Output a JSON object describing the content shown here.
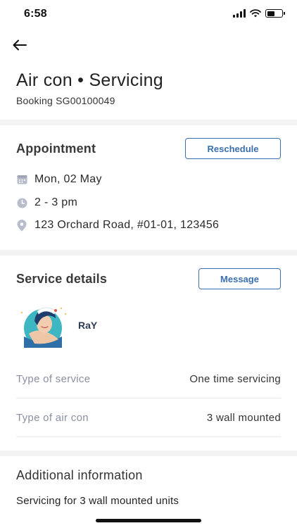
{
  "status_bar": {
    "time": "6:58",
    "battery_level": 0.5
  },
  "nav": {
    "back_icon": "arrow-left-icon"
  },
  "header": {
    "title": "Air con • Servicing",
    "booking": "Booking SG00100049"
  },
  "appointment": {
    "title": "Appointment",
    "reschedule_label": "Reschedule",
    "date": "Mon, 02 May",
    "time": "2 - 3 pm",
    "address": "123 Orchard Road, #01-01, 123456"
  },
  "service_details": {
    "title": "Service details",
    "message_label": "Message",
    "provider_name": "RaY",
    "rows": [
      {
        "label": "Type of service",
        "value": "One time servicing"
      },
      {
        "label": "Type of air con",
        "value": "3 wall mounted"
      }
    ]
  },
  "additional": {
    "title": "Additional information",
    "text": "Servicing for 3 wall mounted units"
  },
  "colors": {
    "accent": "#3a6fb0",
    "divider": "#f3f3f3",
    "label": "#8a90a3"
  }
}
